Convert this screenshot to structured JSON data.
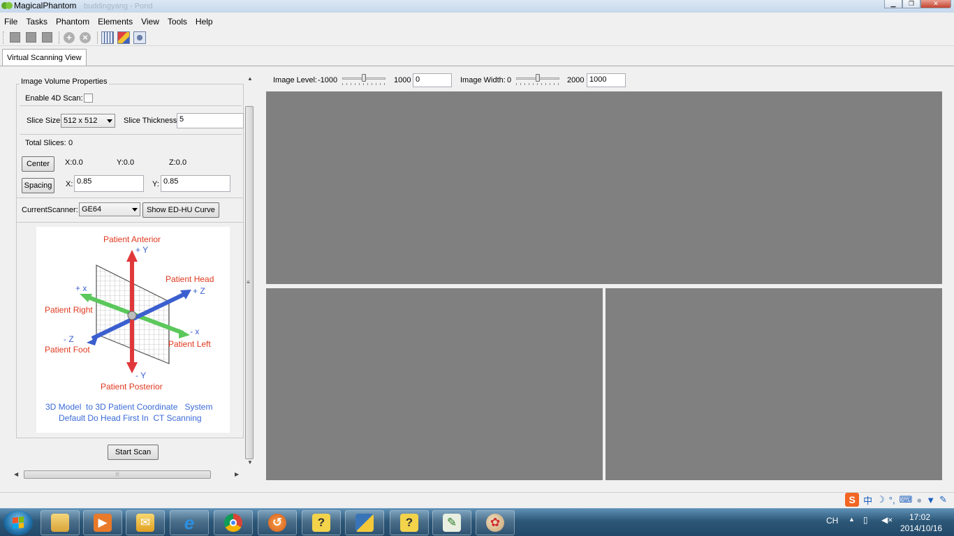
{
  "window": {
    "title": "MagicalPhantom",
    "ghost_title": "buddingyang - Pond"
  },
  "menu": [
    "File",
    "Tasks",
    "Phantom",
    "Elements",
    "View",
    "Tools",
    "Help"
  ],
  "tab": {
    "label": "Virtual Scanning View"
  },
  "volume": {
    "group_title": "Image Volume Properties",
    "enable_4d_label": "Enable 4D Scan:",
    "enable_4d_checked": false,
    "slice_size_label": "Slice Size:",
    "slice_size_value": "512 x 512",
    "slice_thickness_label": "Slice Thickness:",
    "slice_thickness_value": "5",
    "total_slices_label": "Total Slices:",
    "total_slices_value": "0",
    "center_button": "Center",
    "center_x": "X:0.0",
    "center_y": "Y:0.0",
    "center_z": "Z:0.0",
    "spacing_button": "Spacing",
    "spacing_x_label": "X:",
    "spacing_x_value": "0.85",
    "spacing_y_label": "Y:",
    "spacing_y_value": "0.85"
  },
  "scanner": {
    "label": "CurrentScanner:",
    "value": "GE64",
    "curve_button": "Show ED-HU Curve"
  },
  "figure": {
    "anterior": "Patient Anterior",
    "plus_y": "+ Y",
    "head": "Patient Head",
    "plus_z": "+ Z",
    "plus_x": "+ x",
    "right": "Patient Right",
    "minus_x": "- x",
    "minus_z": "- Z",
    "left": "Patient Left",
    "foot": "Patient Foot",
    "minus_y": "- Y",
    "posterior": "Patient Posterior",
    "caption_line1": "3D Model  to 3D Patient Coordinate   System",
    "caption_line2": "Default Do Head First In  CT Scanning"
  },
  "start_button": "Start Scan",
  "image_level": {
    "label": "Image Level:",
    "min": "-1000",
    "max": "1000",
    "value": "0"
  },
  "image_width": {
    "label": "Image Width:",
    "min": "0",
    "max": "2000",
    "value": "1000"
  },
  "slider_levels": {
    "level_fraction": 0.5,
    "width_fraction": 0.5
  },
  "colors": {
    "viewport": "#808080",
    "red_axis": "#e0383a",
    "green_axis": "#5bc85b",
    "blue_axis": "#3b5fcf",
    "label_red": "#e0381e",
    "caption_blue": "#3a6ad8"
  },
  "ime": {
    "lang": "CH"
  },
  "clock": {
    "time": "17:02",
    "date": "2014/10/16"
  },
  "taskbar_icons": [
    "start-orb",
    "file-explorer-icon",
    "media-player-icon",
    "outlook-icon",
    "internet-explorer-icon",
    "chrome-icon",
    "scanner-app-icon",
    "help-icon",
    "python-icon",
    "help-icon-2",
    "editor-icon",
    "paint-icon"
  ]
}
